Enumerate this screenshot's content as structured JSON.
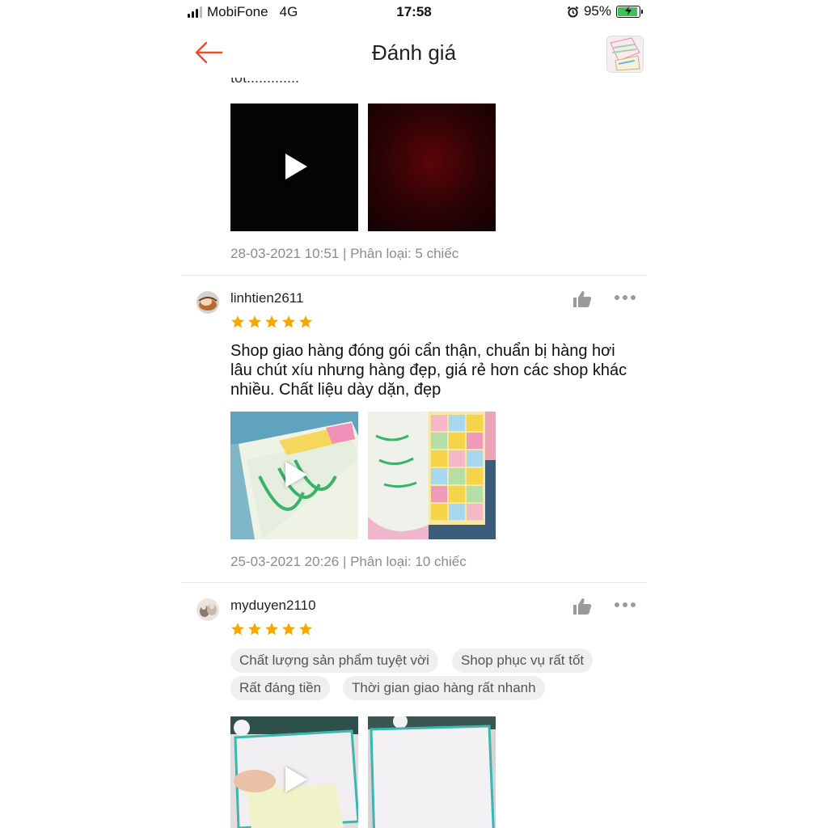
{
  "status_bar": {
    "carrier": "MobiFone",
    "network": "4G",
    "time": "17:58",
    "battery": "95%"
  },
  "header": {
    "title": "Đánh giá"
  },
  "previous_review": {
    "text_fragment": "tốt.............",
    "timestamp_variant": "28-03-2021 10:51 | Phân loại: 5 chiếc"
  },
  "reviews": [
    {
      "username": "linhtien2611",
      "rating": 5,
      "text": "Shop giao hàng đóng gói cẩn thận, chuẩn bị hàng hơi lâu chút xíu nhưng hàng đẹp, giá rẻ hơn các shop khác nhiều. Chất liệu dày dặn, đẹp",
      "timestamp_variant": "25-03-2021 20:26 | Phân loại: 10 chiếc"
    },
    {
      "username": "myduyen2110",
      "rating": 5,
      "tags": [
        "Chất lượng sản phẩm tuyệt vời",
        "Shop phục vụ rất tốt",
        "Rất đáng tiền",
        "Thời gian giao hàng rất nhanh"
      ]
    }
  ],
  "colors": {
    "accent": "#ee4d2d",
    "star": "#f6a700",
    "meta_text": "#8c8c8c"
  },
  "icons": [
    "back-arrow-icon",
    "thumbs-up-icon",
    "more-icon",
    "play-icon",
    "star-icon"
  ]
}
